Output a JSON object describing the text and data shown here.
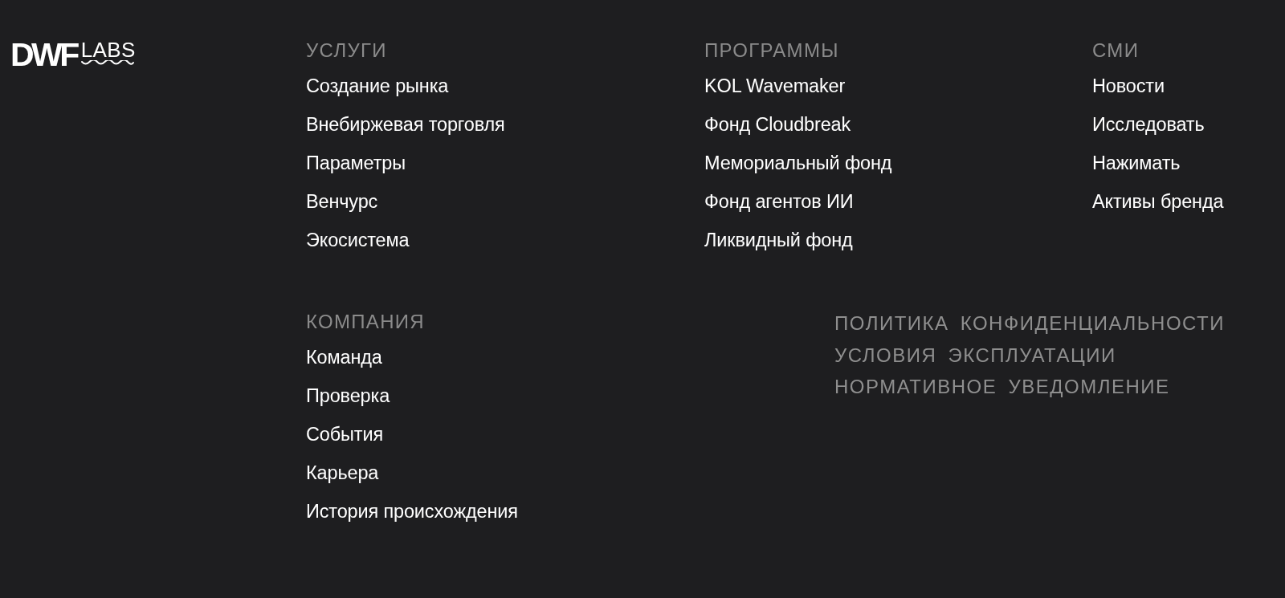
{
  "logo": {
    "wordmark_bold": "DWF",
    "wordmark_light": "LABS"
  },
  "top_row": [
    {
      "heading": "УСЛУГИ",
      "links": [
        "Создание рынка",
        "Внебиржевая торговля",
        "Параметры",
        "Венчурс",
        "Экосистема"
      ]
    },
    {
      "heading": "ПРОГРАММЫ",
      "links": [
        "KOL Wavemaker",
        "Фонд Cloudbreak",
        "Мемориальный фонд",
        "Фонд агентов ИИ",
        "Ликвидный фонд"
      ]
    },
    {
      "heading": "СМИ",
      "links": [
        "Новости",
        "Исследовать",
        "Нажимать",
        "Активы бренда"
      ]
    }
  ],
  "bottom_row": {
    "sections": [
      {
        "heading": "КОМПАНИЯ",
        "links": [
          "Команда",
          "Проверка",
          "События",
          "Карьера",
          "История происхождения"
        ]
      }
    ],
    "legal_links": [
      "ПОЛИТИКА КОНФИДЕНЦИАЛЬНОСТИ",
      "УСЛОВИЯ ЭКСПЛУАТАЦИИ",
      "НОРМАТИВНОЕ УВЕДОМЛЕНИЕ"
    ]
  }
}
